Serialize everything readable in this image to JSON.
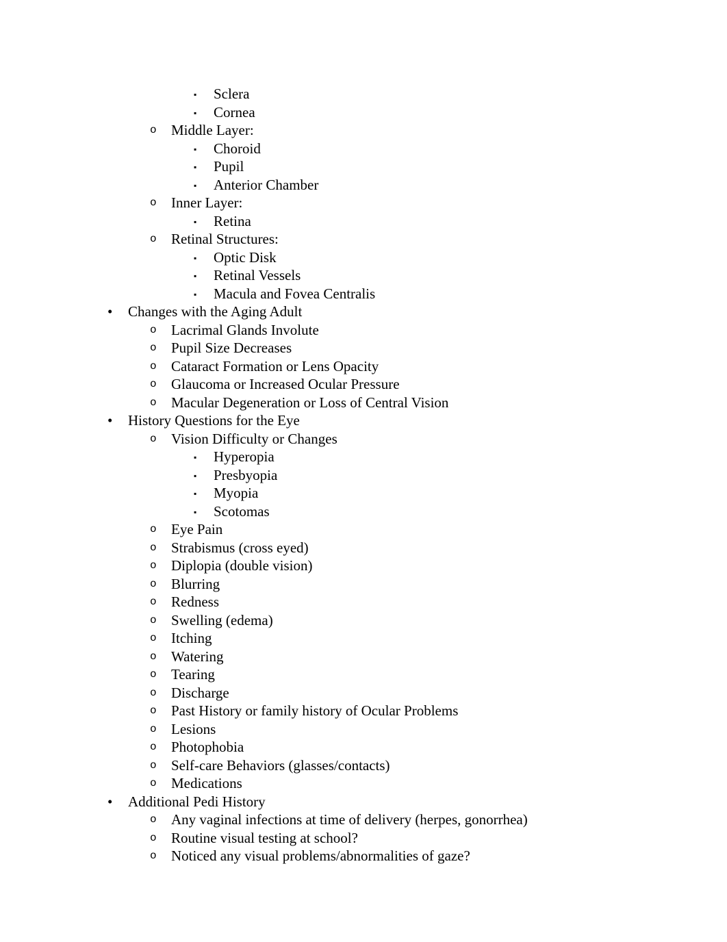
{
  "document": {
    "background_color": "#ffffff",
    "text_color": "#000000",
    "markers": {
      "level1": "•",
      "level2": "o",
      "level3": "▪"
    }
  },
  "outline": [
    {
      "level": 3,
      "text": "Sclera"
    },
    {
      "level": 3,
      "text": "Cornea"
    },
    {
      "level": 2,
      "text": "Middle Layer:"
    },
    {
      "level": 3,
      "text": "Choroid"
    },
    {
      "level": 3,
      "text": "Pupil"
    },
    {
      "level": 3,
      "text": "Anterior Chamber"
    },
    {
      "level": 2,
      "text": "Inner Layer:"
    },
    {
      "level": 3,
      "text": "Retina"
    },
    {
      "level": 2,
      "text": "Retinal Structures:"
    },
    {
      "level": 3,
      "text": "Optic Disk"
    },
    {
      "level": 3,
      "text": "Retinal Vessels"
    },
    {
      "level": 3,
      "text": "Macula and Fovea Centralis"
    },
    {
      "level": 1,
      "text": "Changes with the Aging Adult"
    },
    {
      "level": 2,
      "text": "Lacrimal Glands Involute"
    },
    {
      "level": 2,
      "text": "Pupil Size Decreases"
    },
    {
      "level": 2,
      "text": "Cataract Formation or Lens Opacity"
    },
    {
      "level": 2,
      "text": "Glaucoma or Increased Ocular Pressure"
    },
    {
      "level": 2,
      "text": "Macular Degeneration or Loss of Central Vision"
    },
    {
      "level": 1,
      "text": "History Questions for the Eye"
    },
    {
      "level": 2,
      "text": "Vision Difficulty or Changes"
    },
    {
      "level": 3,
      "text": "Hyperopia"
    },
    {
      "level": 3,
      "text": "Presbyopia"
    },
    {
      "level": 3,
      "text": "Myopia"
    },
    {
      "level": 3,
      "text": "Scotomas"
    },
    {
      "level": 2,
      "text": "Eye Pain"
    },
    {
      "level": 2,
      "text": "Strabismus (cross eyed)"
    },
    {
      "level": 2,
      "text": "Diplopia (double vision)"
    },
    {
      "level": 2,
      "text": "Blurring"
    },
    {
      "level": 2,
      "text": "Redness"
    },
    {
      "level": 2,
      "text": "Swelling (edema)"
    },
    {
      "level": 2,
      "text": "Itching"
    },
    {
      "level": 2,
      "text": "Watering"
    },
    {
      "level": 2,
      "text": "Tearing"
    },
    {
      "level": 2,
      "text": "Discharge"
    },
    {
      "level": 2,
      "text": "Past History or family history of Ocular Problems"
    },
    {
      "level": 2,
      "text": "Lesions"
    },
    {
      "level": 2,
      "text": "Photophobia"
    },
    {
      "level": 2,
      "text": "Self-care Behaviors (glasses/contacts)"
    },
    {
      "level": 2,
      "text": "Medications"
    },
    {
      "level": 1,
      "text": "Additional Pedi History"
    },
    {
      "level": 2,
      "text": "Any vaginal infections at time of delivery (herpes, gonorrhea)"
    },
    {
      "level": 2,
      "text": "Routine visual testing at school?"
    },
    {
      "level": 2,
      "text": "Noticed any visual problems/abnormalities of gaze?"
    }
  ]
}
